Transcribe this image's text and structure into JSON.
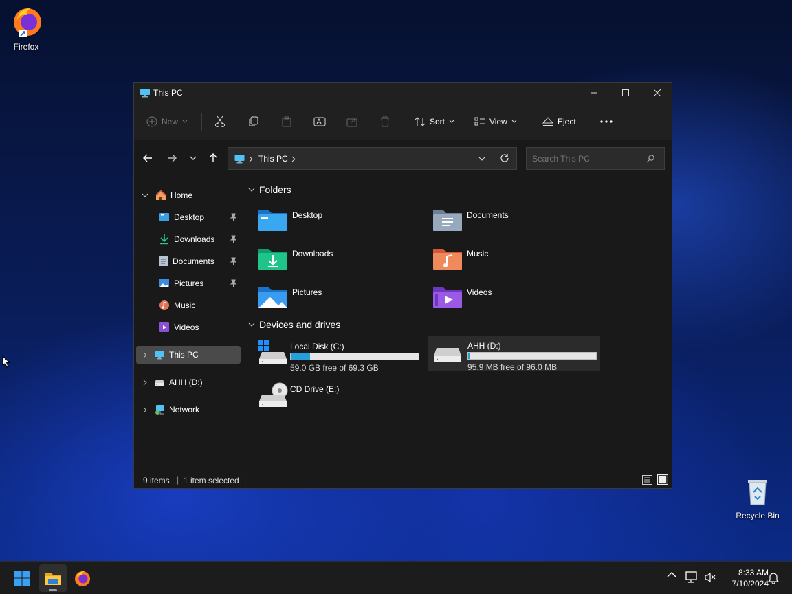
{
  "desktop": {
    "icons": [
      {
        "label": "Firefox"
      },
      {
        "label": "Recycle Bin"
      }
    ]
  },
  "window": {
    "title": "This PC",
    "toolbar": {
      "new_label": "New",
      "sort_label": "Sort",
      "view_label": "View",
      "eject_label": "Eject"
    },
    "address": {
      "path": "This PC"
    },
    "search": {
      "placeholder": "Search This PC"
    },
    "sidebar": {
      "home": "Home",
      "quick": [
        {
          "label": "Desktop"
        },
        {
          "label": "Downloads"
        },
        {
          "label": "Documents"
        },
        {
          "label": "Pictures"
        },
        {
          "label": "Music"
        },
        {
          "label": "Videos"
        }
      ],
      "this_pc": "This PC",
      "drive": "AHH (D:)",
      "network": "Network"
    },
    "content": {
      "folders_heading": "Folders",
      "folders": [
        {
          "label": "Desktop"
        },
        {
          "label": "Documents"
        },
        {
          "label": "Downloads"
        },
        {
          "label": "Music"
        },
        {
          "label": "Pictures"
        },
        {
          "label": "Videos"
        }
      ],
      "drives_heading": "Devices and drives",
      "drives": [
        {
          "name": "Local Disk (C:)",
          "free": "59.0 GB free of 69.3 GB",
          "used_fraction": 0.15
        },
        {
          "name": "AHH (D:)",
          "free": "95.9 MB free of 96.0 MB",
          "used_fraction": 0.01
        },
        {
          "name": "CD Drive (E:)"
        }
      ]
    },
    "status": {
      "items": "9 items",
      "selected": "1 item selected"
    }
  },
  "taskbar": {
    "time": "8:33 AM",
    "date": "7/10/2024"
  },
  "colors": {
    "accent": "#26a0da",
    "window_bg": "#191919",
    "selected_bg": "#4a4a4a"
  }
}
